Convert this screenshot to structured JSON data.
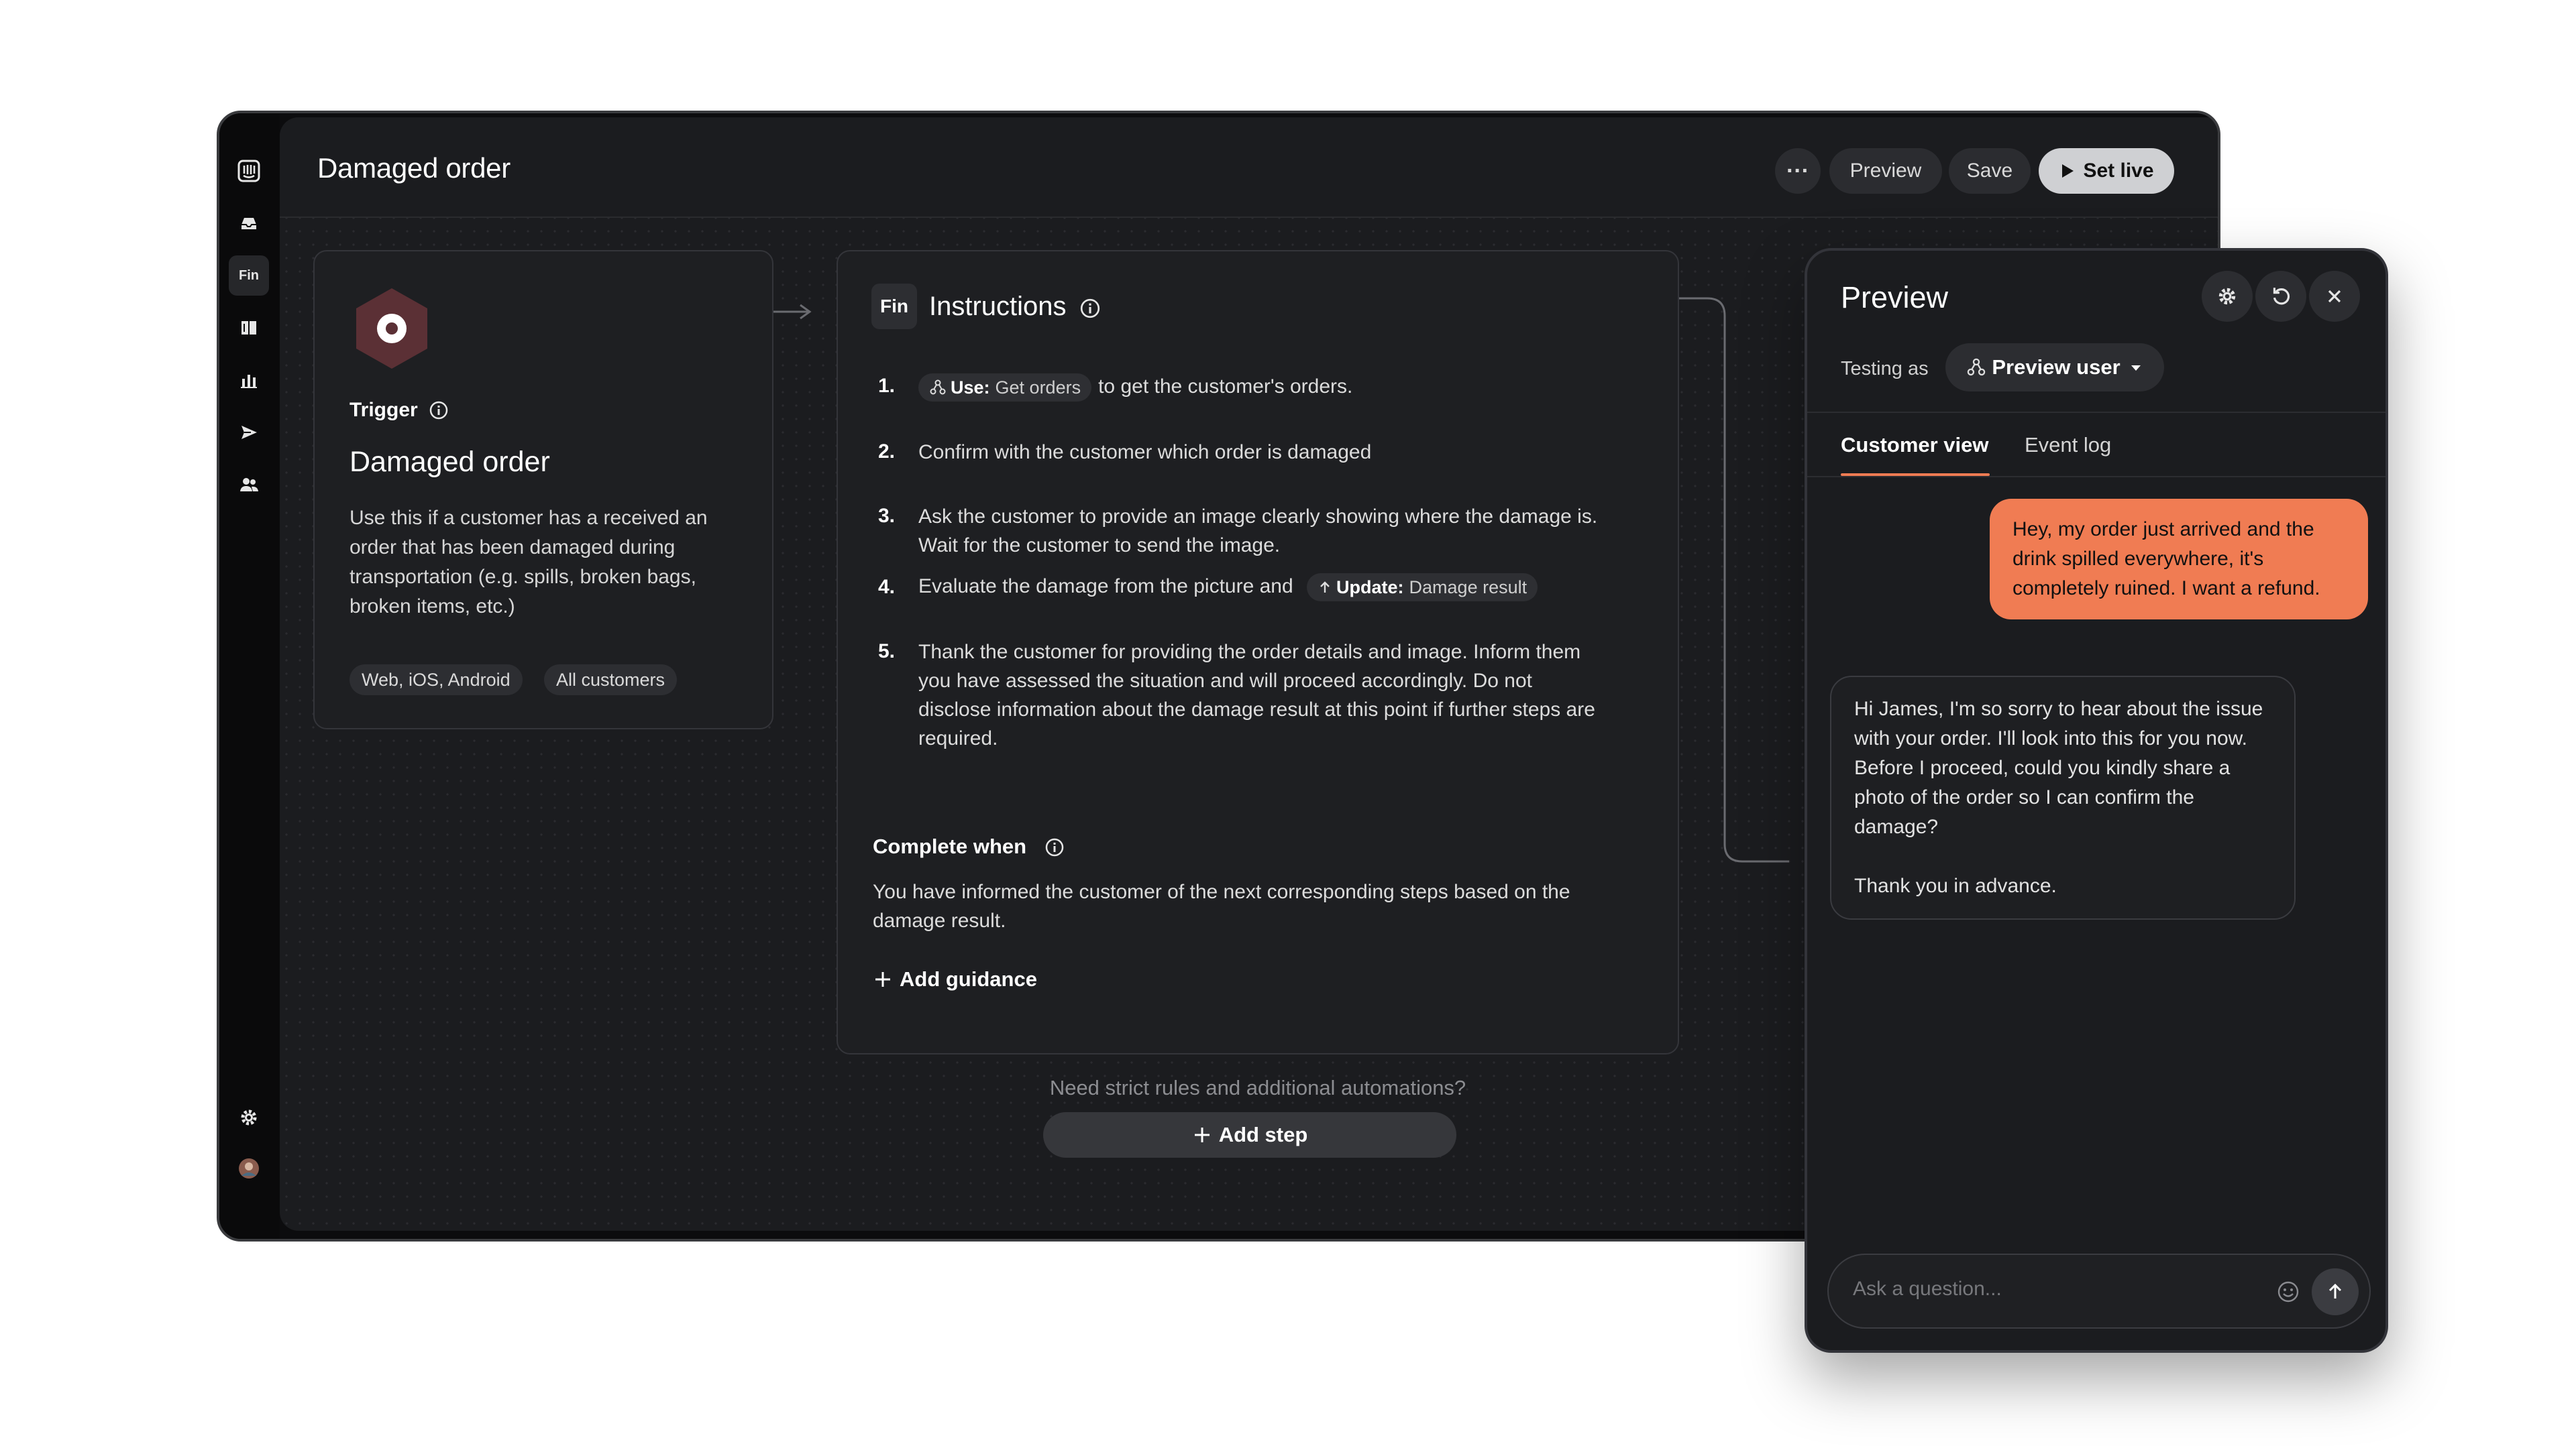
{
  "app": {
    "title": "Damaged order"
  },
  "toolbar": {
    "more_label": "···",
    "preview_label": "Preview",
    "save_label": "Save",
    "setlive_label": "Set live"
  },
  "sidebar": {
    "fin_label": "Fin"
  },
  "trigger": {
    "label": "Trigger",
    "title": "Damaged order",
    "description": "Use this if a customer has a received an order that has been damaged during transportation (e.g. spills, broken bags, broken items, etc.)",
    "tags": [
      "Web, iOS, Android",
      "All customers"
    ]
  },
  "instructions": {
    "badge": "Fin",
    "title": "Instructions",
    "steps": [
      {
        "num": "1.",
        "pill_bold": "Use:",
        "pill_text": "Get orders",
        "text": "to get the customer's orders."
      },
      {
        "num": "2.",
        "text": "Confirm with the customer which order is damaged"
      },
      {
        "num": "3.",
        "text": "Ask the customer to provide an image clearly showing where the damage is. Wait for the customer to send the image."
      },
      {
        "num": "4.",
        "text": "Evaluate the damage from the picture and",
        "pill_bold": "Update:",
        "pill_text": "Damage result"
      },
      {
        "num": "5.",
        "text": "Thank the customer for providing the order details and image. Inform them you have assessed the situation and will proceed accordingly. Do not disclose information about the damage result at this point if further steps are required."
      }
    ],
    "complete_label": "Complete when",
    "complete_text": "You have informed the customer of the next corresponding steps based on the damage result.",
    "add_guidance": "Add guidance"
  },
  "footer": {
    "strict_text": "Need strict rules and additional automations?",
    "add_step": "Add step"
  },
  "preview": {
    "title": "Preview",
    "testing_as": "Testing as",
    "user": "Preview user",
    "tabs": [
      "Customer view",
      "Event log"
    ],
    "messages": [
      {
        "from": "customer",
        "text": "Hey, my order just arrived and the drink spilled everywhere, it's completely ruined. I want a refund."
      },
      {
        "from": "bot",
        "text": "Hi James, I'm so sorry to hear about the issue with your order. I'll look into this for you now. Before I proceed, could you kindly share a photo of the order so I can confirm the damage?",
        "text2": "Thank you in advance."
      }
    ],
    "composer_placeholder": "Ask a question..."
  },
  "colors": {
    "accent": "#f07c53",
    "canvas": "#1b1c1f",
    "card": "#1e1f22"
  }
}
